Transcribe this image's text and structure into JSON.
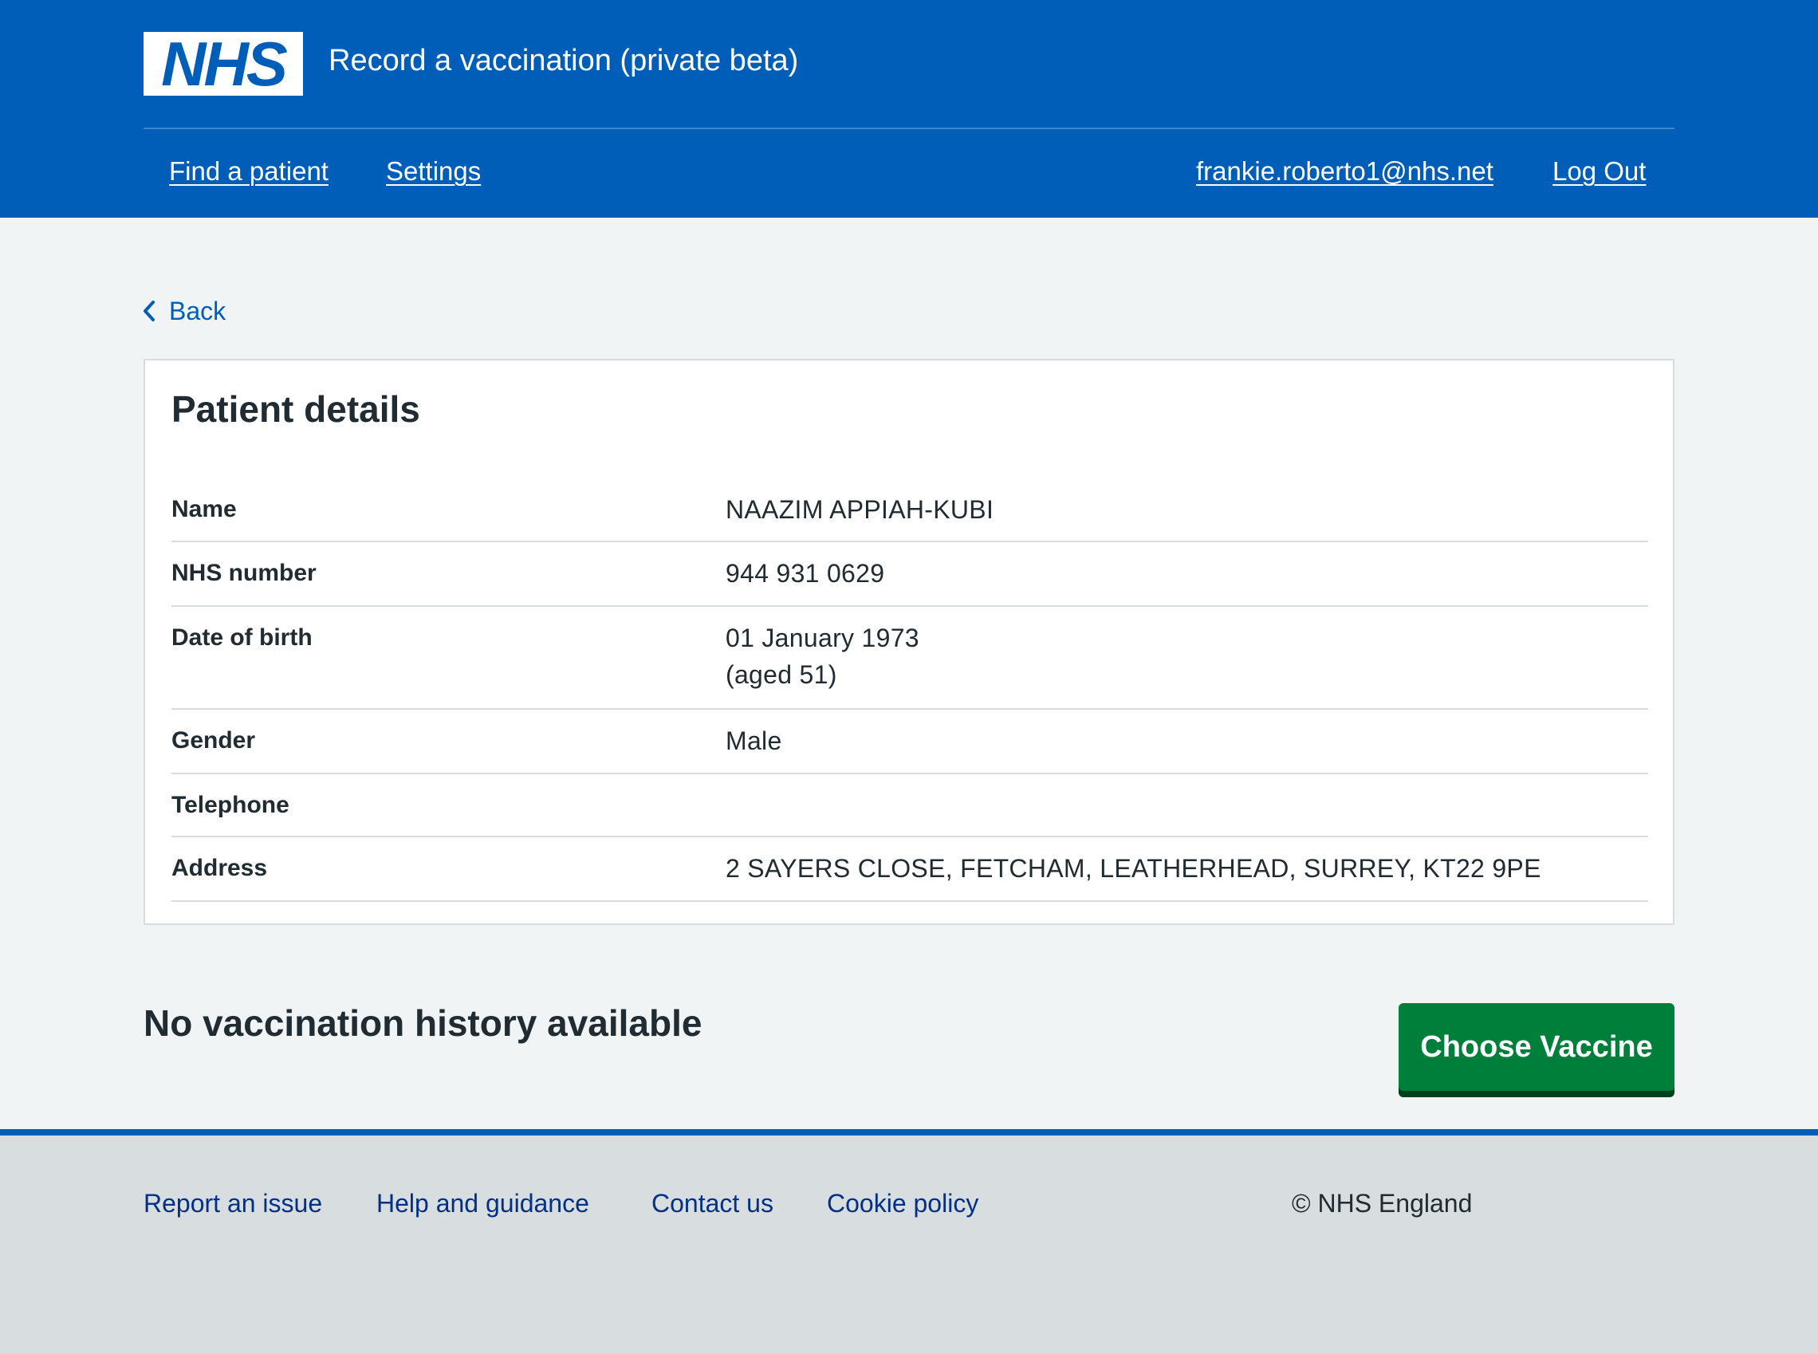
{
  "header": {
    "logo_text": "NHS",
    "service_name": "Record a vaccination (private beta)",
    "nav": {
      "find_patient": "Find a patient",
      "settings": "Settings",
      "user_email": "frankie.roberto1@nhs.net",
      "log_out": "Log Out"
    }
  },
  "back_link": "Back",
  "patient_card": {
    "title": "Patient details",
    "rows": [
      {
        "key": "Name",
        "value": "NAAZIM APPIAH-KUBI"
      },
      {
        "key": "NHS number",
        "value": "944 931 0629"
      },
      {
        "key": "Date of birth",
        "value": "01 January 1973",
        "value2": "(aged 51)"
      },
      {
        "key": "Gender",
        "value": "Male"
      },
      {
        "key": "Telephone",
        "value": ""
      },
      {
        "key": "Address",
        "value": "2 SAYERS CLOSE, FETCHAM, LEATHERHEAD, SURREY, KT22 9PE"
      }
    ]
  },
  "history": {
    "heading": "No vaccination history available",
    "choose_vaccine_label": "Choose Vaccine"
  },
  "footer": {
    "links": [
      "Report an issue",
      "Help and guidance",
      "Contact us",
      "Cookie policy"
    ],
    "copyright": "© NHS England"
  },
  "colors": {
    "nhs_blue": "#005eb8",
    "green_button": "#007f3b",
    "page_background": "#f0f4f5",
    "footer_background": "#d8dde0",
    "text": "#212b32",
    "footer_link": "#003087"
  }
}
